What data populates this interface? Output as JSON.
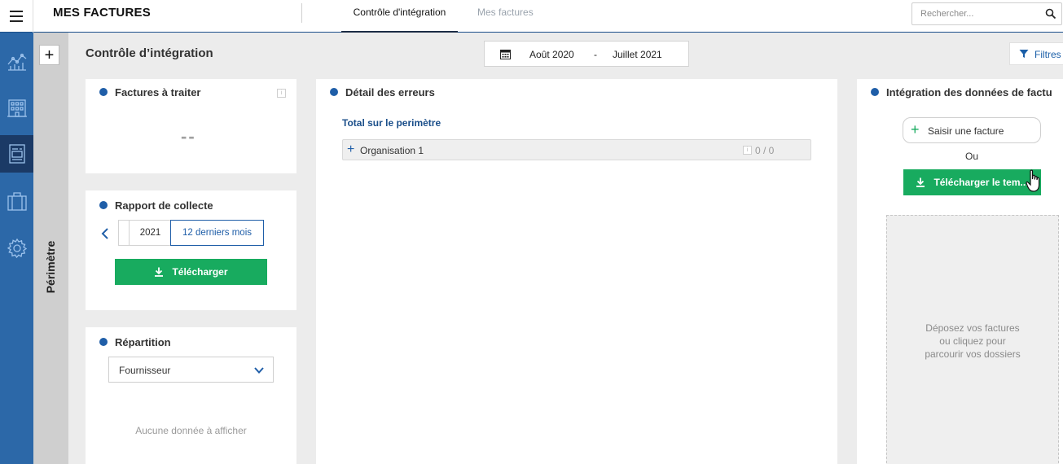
{
  "header": {
    "app_title": "MES FACTURES",
    "tabs": [
      {
        "label": "Contrôle d'intégration",
        "active": true
      },
      {
        "label": "Mes factures",
        "active": false
      }
    ],
    "search_placeholder": "Rechercher..."
  },
  "sidebar": {
    "items": [
      {
        "icon": "chart-line-icon",
        "active": false
      },
      {
        "icon": "building-icon",
        "active": false
      },
      {
        "icon": "invoice-icon",
        "active": true
      },
      {
        "icon": "briefcase-icon",
        "active": false
      },
      {
        "icon": "gear-icon",
        "active": false
      }
    ]
  },
  "perimeter": {
    "label": "Périmètre",
    "add_label": "+"
  },
  "page": {
    "title": "Contrôle d’intégration",
    "date_from": "Août 2020",
    "date_separator": "-",
    "date_to": "Juillet 2021",
    "filters_label": "Filtres"
  },
  "factures_panel": {
    "title": "Factures à traiter",
    "value": "--"
  },
  "rapport_panel": {
    "title": "Rapport de collecte",
    "year": "2021",
    "period": "12 derniers mois",
    "download_label": "Télécharger"
  },
  "repartition_panel": {
    "title": "Répartition",
    "select_value": "Fournisseur",
    "empty_message": "Aucune donnée à afficher"
  },
  "erreurs_panel": {
    "title": "Détail des erreurs",
    "total_label": "Total sur le perimètre",
    "rows": [
      {
        "name": "Organisation 1",
        "count": "0 / 0"
      }
    ]
  },
  "integration_panel": {
    "title": "Intégration des données de factu",
    "add_invoice_label": "Saisir une facture",
    "or_label": "Ou",
    "template_label": "Télécharger le tem...",
    "dropzone_line1": "Déposez vos factures",
    "dropzone_line2": "ou cliquez pour",
    "dropzone_line3": "parcourir vos dossiers"
  },
  "colors": {
    "sidebar": "#2c68a8",
    "sidebar_active": "#1b3a66",
    "accent_blue": "#1f5ea8",
    "green": "#18ab5f"
  }
}
